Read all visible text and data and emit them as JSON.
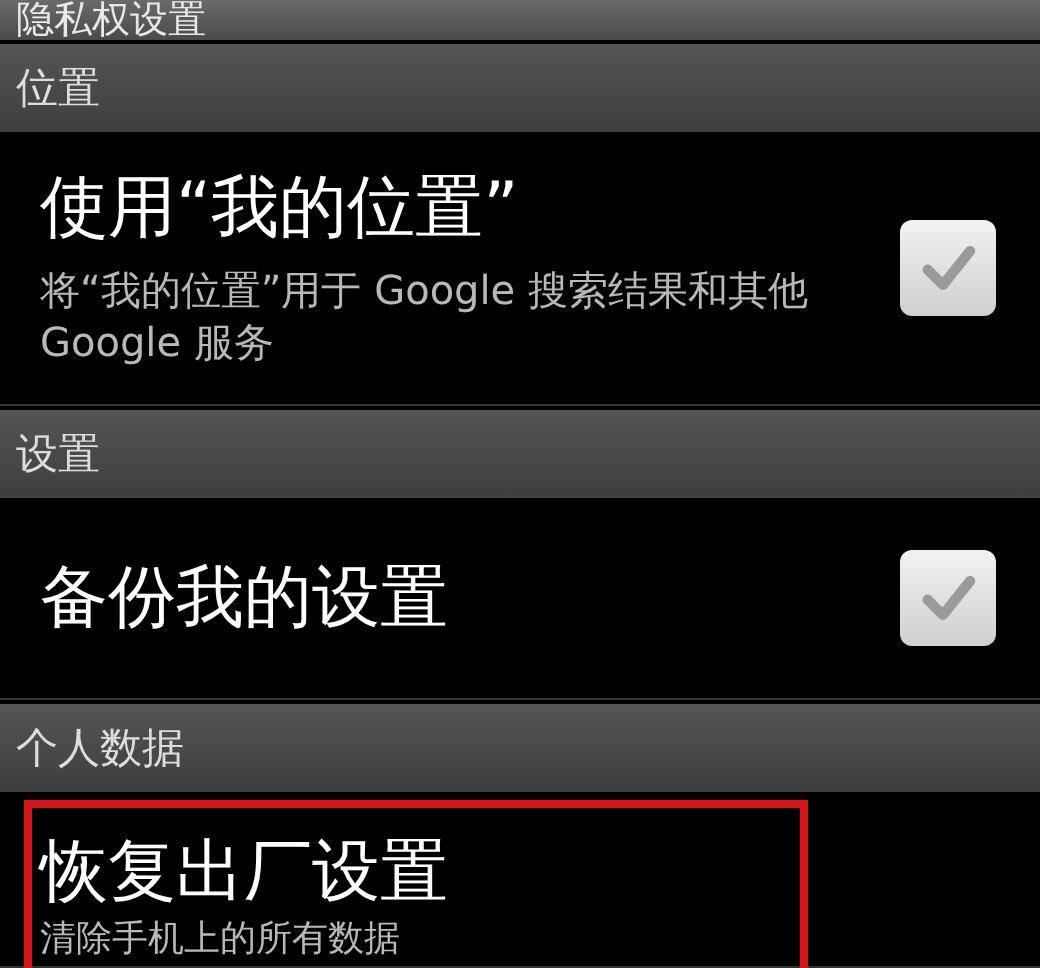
{
  "title": "隐私权设置",
  "sections": [
    {
      "header": "位置",
      "items": [
        {
          "kind": "checkbox",
          "title": "使用“我的位置”",
          "summary": "将“我的位置”用于 Google 搜索结果和其他 Google 服务",
          "checked": true,
          "highlighted": false
        }
      ]
    },
    {
      "header": "设置",
      "items": [
        {
          "kind": "checkbox",
          "title": "备份我的设置",
          "checked": true,
          "highlighted": false
        }
      ]
    },
    {
      "header": "个人数据",
      "items": [
        {
          "kind": "action",
          "title": "恢复出厂设置",
          "summary": "清除手机上的所有数据",
          "highlighted": true
        }
      ]
    }
  ]
}
